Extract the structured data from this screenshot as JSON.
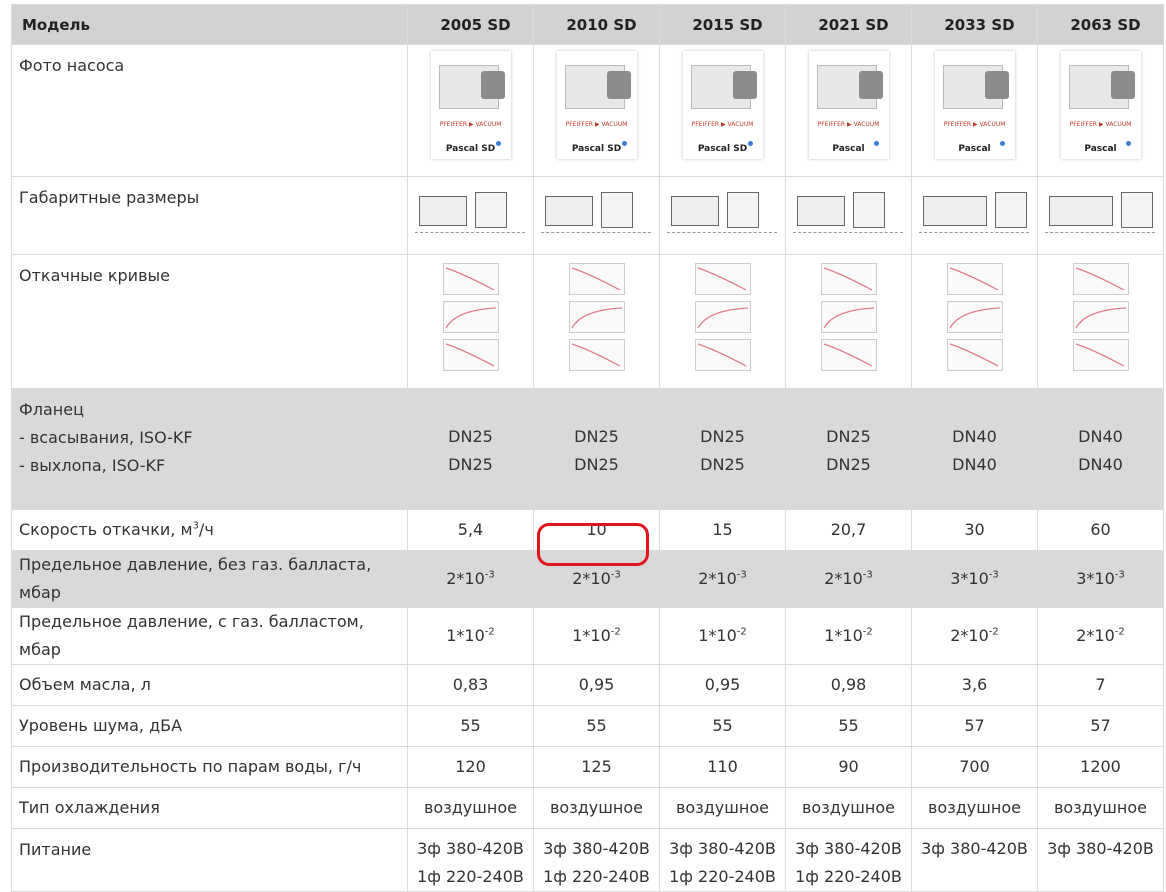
{
  "header": {
    "first": "Модель",
    "models": [
      "2005 SD",
      "2010 SD",
      "2015 SD",
      "2021 SD",
      "2033 SD",
      "2063 SD"
    ]
  },
  "rows": {
    "photo": {
      "label": "Фото насоса",
      "brand": "PFEIFFER ▶ VACUUM",
      "captions": [
        "Pascal SD",
        "Pascal SD",
        "Pascal SD",
        "Pascal",
        "Pascal",
        "Pascal"
      ]
    },
    "dims": {
      "label": "Габаритные размеры"
    },
    "curves": {
      "label": "Откачные кривые"
    },
    "flange": {
      "label_title": "Фланец",
      "label_in": "- всасывания, ISO-KF",
      "label_out": "- выхлопа, ISO-KF",
      "inlet": [
        "DN25",
        "DN25",
        "DN25",
        "DN25",
        "DN40",
        "DN40"
      ],
      "outlet": [
        "DN25",
        "DN25",
        "DN25",
        "DN25",
        "DN40",
        "DN40"
      ]
    },
    "speed": {
      "label": "Скорость откачки, м",
      "label_sup": "3",
      "label_tail": "/ч",
      "values": [
        "5,4",
        "10",
        "15",
        "20,7",
        "30",
        "60"
      ]
    },
    "pressure_no_ballast": {
      "label": "Предельное давление, без газ. балласта, мбар",
      "values": [
        "2*10",
        "2*10",
        "2*10",
        "2*10",
        "3*10",
        "3*10"
      ],
      "exps": [
        "-3",
        "-3",
        "-3",
        "-3",
        "-3",
        "-3"
      ]
    },
    "pressure_ballast": {
      "label": "Предельное давление, с газ. балластом, мбар",
      "values": [
        "1*10",
        "1*10",
        "1*10",
        "1*10",
        "2*10",
        "2*10"
      ],
      "exps": [
        "-2",
        "-2",
        "-2",
        "-2",
        "-2",
        "-2"
      ]
    },
    "oil": {
      "label": "Объем масла, л",
      "values": [
        "0,83",
        "0,95",
        "0,95",
        "0,98",
        "3,6",
        "7"
      ]
    },
    "noise": {
      "label": "Уровень шума, дБА",
      "values": [
        "55",
        "55",
        "55",
        "55",
        "57",
        "57"
      ]
    },
    "water": {
      "label": "Производительность по парам воды, г/ч",
      "values": [
        "120",
        "125",
        "110",
        "90",
        "700",
        "1200"
      ]
    },
    "cooling": {
      "label": "Тип охлаждения",
      "values": [
        "воздушное",
        "воздушное",
        "воздушное",
        "воздушное",
        "воздушное",
        "воздушное"
      ]
    },
    "power": {
      "label": "Питание",
      "line1": [
        "3ф 380-420В",
        "3ф 380-420В",
        "3ф 380-420В",
        "3ф 380-420В",
        "3ф 380-420В",
        "3ф 380-420В"
      ],
      "line2": [
        "1ф 220-240В",
        "1ф 220-240В",
        "1ф 220-240В",
        "1ф 220-240В",
        "",
        ""
      ]
    }
  },
  "colors": {
    "header_bg": "#d2d2d2",
    "gray_row": "#d9d9d9",
    "highlight": "#e0141a"
  }
}
